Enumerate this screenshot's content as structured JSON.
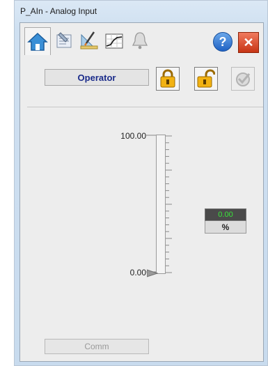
{
  "window": {
    "title": "P_AIn - Analog Input"
  },
  "tabs": [
    {
      "icon": "home-icon"
    },
    {
      "icon": "maintenance-icon"
    },
    {
      "icon": "engineering-icon"
    },
    {
      "icon": "trend-icon"
    },
    {
      "icon": "alarm-bell-icon"
    }
  ],
  "toolbar": {
    "help_label": "?",
    "close_label": "✕"
  },
  "operator": {
    "status_label": "Operator"
  },
  "scale": {
    "max_label": "100.00",
    "min_label": "0.00",
    "value_percent": 0
  },
  "value_display": {
    "value": "0.00",
    "units": "%"
  },
  "footer": {
    "comm_label": "Comm"
  },
  "colors": {
    "value_text": "#39e539",
    "status_text": "#1a2b8a",
    "lock_gold": "#f2b212"
  }
}
